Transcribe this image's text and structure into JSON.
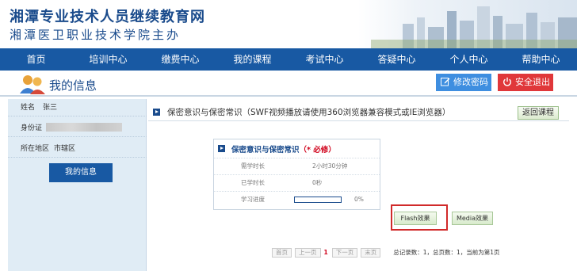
{
  "header": {
    "title": "湘潭专业技术人员继续教育网",
    "subtitle": "湘潭医卫职业技术学院主办"
  },
  "nav": {
    "items": [
      "首页",
      "培训中心",
      "缴费中心",
      "我的课程",
      "考试中心",
      "答疑中心",
      "个人中心",
      "帮助中心"
    ]
  },
  "titlebar": {
    "title": "我的信息",
    "change_password": "修改密码",
    "logout": "安全退出"
  },
  "sidebar": {
    "name_label": "姓名",
    "name_value": "张三",
    "id_label": "身份证",
    "region_label": "所在地区",
    "region_value": "市辖区",
    "my_info_button": "我的信息"
  },
  "course": {
    "header_text": "保密意识与保密常识（SWF视频播放请使用360浏览器兼容模式或IE浏览器）",
    "back_button": "返回课程",
    "card_title": "保密意识与保密常识",
    "required_text": "（* 必修）",
    "rows": [
      {
        "key": "需学时长",
        "value": "2小时30分钟"
      },
      {
        "key": "已学时长",
        "value": "0秒"
      }
    ],
    "progress_label": "学习进度",
    "progress_value": "0%",
    "progress_fraction": 0,
    "flash_button": "Flash效果",
    "media_button": "Media效果"
  },
  "pager": {
    "first": "首页",
    "prev": "上一页",
    "current": "1",
    "next": "下一页",
    "last": "末页",
    "summary": "总记录数：1，总页数：1，当前为第1页"
  },
  "colors": {
    "primary": "#1859a3",
    "title_blue": "#1a4b8c",
    "password_button": "#3e8ee0",
    "logout_button": "#e0373a",
    "sidebar_bg": "#e0ecf5",
    "highlight_red": "#d12a2a"
  }
}
